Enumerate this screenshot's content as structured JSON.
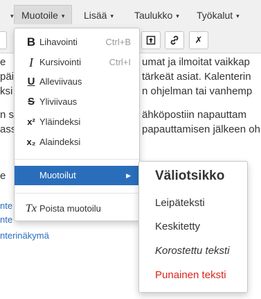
{
  "menubar": {
    "items": [
      {
        "label": "Muotoile"
      },
      {
        "label": "Lisää"
      },
      {
        "label": "Taulukko"
      },
      {
        "label": "Työkalut"
      }
    ],
    "left_fragment": "e"
  },
  "editor": {
    "lines": [
      "umat ja ilmoitat vaikkap",
      "päiv",
      "tärkeät asiat. Kalenterin",
      "ksi",
      "n ohjelman tai vanhemp",
      "n s",
      "ähköpostiin napauttam",
      "assa",
      "papauttamisen jälkeen oh",
      "e"
    ],
    "links": [
      "nte",
      "nte",
      "nterinäkymä"
    ]
  },
  "dropdown": {
    "items": [
      {
        "label": "Lihavointi",
        "shortcut": "Ctrl+B",
        "icon": "B"
      },
      {
        "label": "Kursivointi",
        "shortcut": "Ctrl+I",
        "icon": "I"
      },
      {
        "label": "Alleviivaus",
        "shortcut": "",
        "icon": "U"
      },
      {
        "label": "Yliviivaus",
        "shortcut": "",
        "icon": "S"
      },
      {
        "label": "Yläindeksi",
        "shortcut": "",
        "icon": "x²"
      },
      {
        "label": "Alaindeksi",
        "shortcut": "",
        "icon": "x₂"
      }
    ],
    "formats_label": "Muotoilut",
    "clear_label": "Poista muotoilu",
    "clear_icon": "Tx"
  },
  "submenu": {
    "items": [
      {
        "label": "Väliotsikko"
      },
      {
        "label": "Leipäteksti"
      },
      {
        "label": "Keskitetty"
      },
      {
        "label": "Korostettu teksti"
      },
      {
        "label": "Punainen teksti"
      }
    ],
    "red_color": "#d9261c"
  },
  "colors": {
    "accent": "#2a6ebb"
  }
}
